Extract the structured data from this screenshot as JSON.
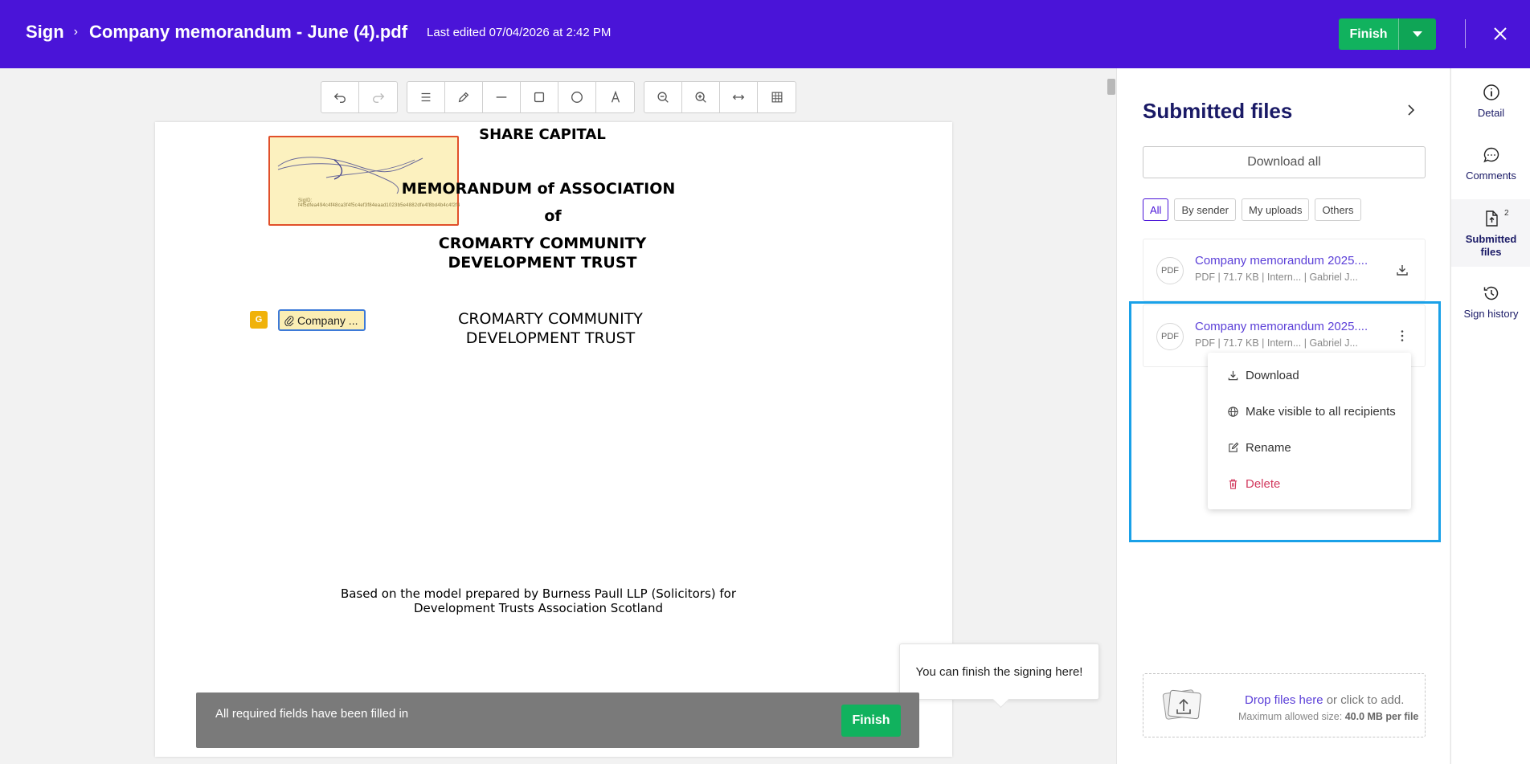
{
  "header": {
    "app": "Sign",
    "document_title": "Company memorandum - June (4).pdf",
    "last_edited": "Last edited 07/04/2026 at 2:42 PM",
    "finish_label": "Finish"
  },
  "toolbar": {
    "groups": [
      [
        "undo-icon",
        "redo-icon"
      ],
      [
        "list-icon",
        "pencil-icon",
        "line-icon",
        "rectangle-icon",
        "circle-icon",
        "text-icon"
      ],
      [
        "zoom-out-icon",
        "zoom-in-icon",
        "fit-width-icon",
        "grid-icon"
      ]
    ]
  },
  "document": {
    "share_capital": "SHARE CAPITAL",
    "memo_title": "MEMORANDUM of ASSOCIATION",
    "of": "of",
    "org_bold_1": "CROMARTY COMMUNITY",
    "org_bold_2": "DEVELOPMENT TRUST",
    "org_1": "CROMARTY COMMUNITY",
    "org_2": "DEVELOPMENT TRUST",
    "footer_1": "Based on the model prepared by Burness Paull LLP (Solicitors) for",
    "footer_2": "Development Trusts Association Scotland",
    "signature_id": "SigID: f4f5dfea494c4f48ca3f4f5c4ef3f84eaad1023b5e4882dfe4f8bd4b4c4f2f4",
    "marker_letter": "G",
    "attachment_label": "Company ..."
  },
  "banner": {
    "text": "All required fields have been filled in",
    "finish_label": "Finish",
    "tooltip": "You can finish the signing here!"
  },
  "panel": {
    "title": "Submitted files",
    "download_all": "Download all",
    "filters": [
      "All",
      "By sender",
      "My uploads",
      "Others"
    ],
    "active_filter": "All",
    "files": [
      {
        "badge": "PDF",
        "name": "Company memorandum 2025....",
        "meta": "PDF  |  71.7 KB  |  Intern...   |  Gabriel J..."
      },
      {
        "badge": "PDF",
        "name": "Company memorandum 2025....",
        "meta": "PDF  |  71.7 KB  |  Intern...   |  Gabriel J..."
      }
    ],
    "menu": {
      "download": "Download",
      "make_visible": "Make visible to all recipients",
      "rename": "Rename",
      "delete": "Delete"
    },
    "dropzone": {
      "link": "Drop files here",
      "rest": " or click to add.",
      "limit_prefix": "Maximum allowed size: ",
      "limit_value": "40.0 MB per file"
    }
  },
  "rail": {
    "detail": "Detail",
    "comments": "Comments",
    "submitted_line1": "Submitted",
    "submitted_line2": "files",
    "submitted_count": "2",
    "history": "Sign history"
  },
  "colors": {
    "header_bg": "#4a14d8",
    "finish_green": "#11b25e",
    "highlight_blue": "#1aa1e8",
    "danger": "#d2395e"
  }
}
